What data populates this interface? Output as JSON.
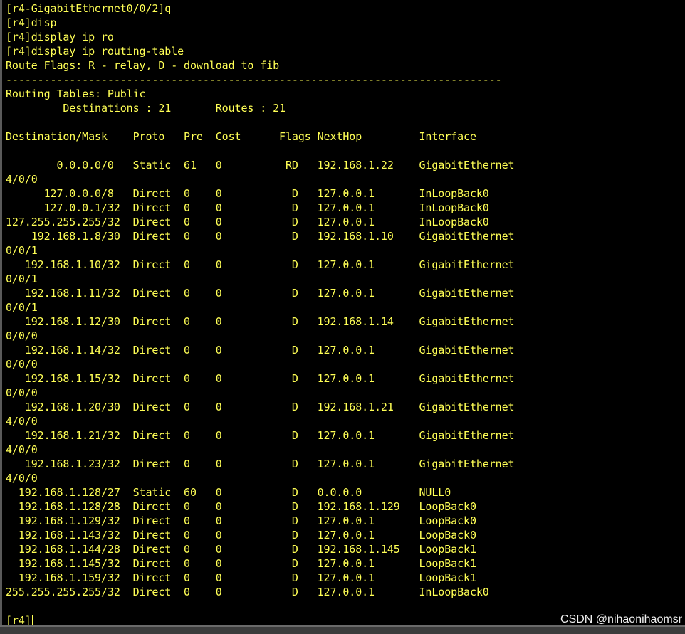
{
  "terminal": {
    "lines": [
      "[r4-GigabitEthernet0/0/2]q",
      "[r4]disp",
      "[r4]display ip ro",
      "[r4]display ip routing-table",
      "Route Flags: R - relay, D - download to fib",
      "------------------------------------------------------------------------------",
      "Routing Tables: Public",
      "         Destinations : 21       Routes : 21",
      "",
      "Destination/Mask    Proto   Pre  Cost      Flags NextHop         Interface",
      "",
      "        0.0.0.0/0   Static  61   0          RD   192.168.1.22    GigabitEthernet",
      "4/0/0",
      "      127.0.0.0/8   Direct  0    0           D   127.0.0.1       InLoopBack0",
      "      127.0.0.1/32  Direct  0    0           D   127.0.0.1       InLoopBack0",
      "127.255.255.255/32  Direct  0    0           D   127.0.0.1       InLoopBack0",
      "    192.168.1.8/30  Direct  0    0           D   192.168.1.10    GigabitEthernet",
      "0/0/1",
      "   192.168.1.10/32  Direct  0    0           D   127.0.0.1       GigabitEthernet",
      "0/0/1",
      "   192.168.1.11/32  Direct  0    0           D   127.0.0.1       GigabitEthernet",
      "0/0/1",
      "   192.168.1.12/30  Direct  0    0           D   192.168.1.14    GigabitEthernet",
      "0/0/0",
      "   192.168.1.14/32  Direct  0    0           D   127.0.0.1       GigabitEthernet",
      "0/0/0",
      "   192.168.1.15/32  Direct  0    0           D   127.0.0.1       GigabitEthernet",
      "0/0/0",
      "   192.168.1.20/30  Direct  0    0           D   192.168.1.21    GigabitEthernet",
      "4/0/0",
      "   192.168.1.21/32  Direct  0    0           D   127.0.0.1       GigabitEthernet",
      "4/0/0",
      "   192.168.1.23/32  Direct  0    0           D   127.0.0.1       GigabitEthernet",
      "4/0/0",
      "  192.168.1.128/27  Static  60   0           D   0.0.0.0         NULL0",
      "  192.168.1.128/28  Direct  0    0           D   192.168.1.129   LoopBack0",
      "  192.168.1.129/32  Direct  0    0           D   127.0.0.1       LoopBack0",
      "  192.168.1.143/32  Direct  0    0           D   127.0.0.1       LoopBack0",
      "  192.168.1.144/28  Direct  0    0           D   192.168.1.145   LoopBack1",
      "  192.168.1.145/32  Direct  0    0           D   127.0.0.1       LoopBack1",
      "  192.168.1.159/32  Direct  0    0           D   127.0.0.1       LoopBack1",
      "255.255.255.255/32  Direct  0    0           D   127.0.0.1       InLoopBack0",
      ""
    ],
    "prompt": "[r4]"
  },
  "watermark": "CSDN @nihaonihaomsr",
  "colors": {
    "background": "#000000",
    "text": "#ffff55"
  }
}
